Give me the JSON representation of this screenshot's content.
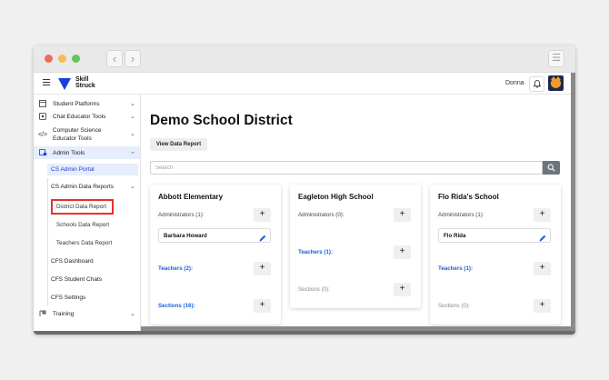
{
  "header": {
    "logo_line1": "Skill",
    "logo_line2": "Struck",
    "user_name": "Donna"
  },
  "sidebar": {
    "items": [
      {
        "label": "Student Platforms",
        "icon": "window-icon",
        "chevron": "chevron-down"
      },
      {
        "label": "Chat Educator Tools",
        "icon": "chat-icon",
        "chevron": "chevron-down"
      },
      {
        "label_line1": "Computer Science",
        "label_line2": "Educator Tools",
        "icon": "code-icon",
        "chevron": "chevron-down"
      },
      {
        "label": "Admin Tools",
        "icon": "admin-icon",
        "chevron": "chevron-up"
      }
    ],
    "admin_sub": {
      "portal": "CS Admin Portal",
      "data_reports": "CS Admin Data Reports",
      "reports": [
        "District Data Report",
        "Schools Data Report",
        "Teachers Data Report"
      ],
      "cfs_dashboard": "CFS Dashboard",
      "cfs_chats": "CFS Student Chats",
      "cfs_settings": "CFS Settings"
    },
    "training": {
      "label": "Training",
      "icon": "training-icon"
    }
  },
  "main": {
    "title": "Demo School District",
    "view_report_label": "View Data Report",
    "search_placeholder": "Search",
    "cards": [
      {
        "name": "Abbott Elementary",
        "administrators_label": "Administrators (1):",
        "administrator": "Barbara Howard",
        "teachers_label": "Teachers (2):",
        "sections_label": "Sections (16):"
      },
      {
        "name": "Eagleton High School",
        "administrators_label": "Administrators (0):",
        "teachers_label": "Teachers (1):",
        "sections_label": "Sections (0):"
      },
      {
        "name": "Flo Rida's School",
        "administrators_label": "Administrators (1):",
        "administrator": "Flo Rida",
        "teachers_label": "Teachers (1):",
        "sections_label": "Sections (0):"
      }
    ],
    "plus_symbol": "+"
  },
  "colors": {
    "accent": "#1b5fd9",
    "logo": "#1b3fd9",
    "highlight_border": "#e8312a",
    "active_bg": "#e6edfc"
  }
}
